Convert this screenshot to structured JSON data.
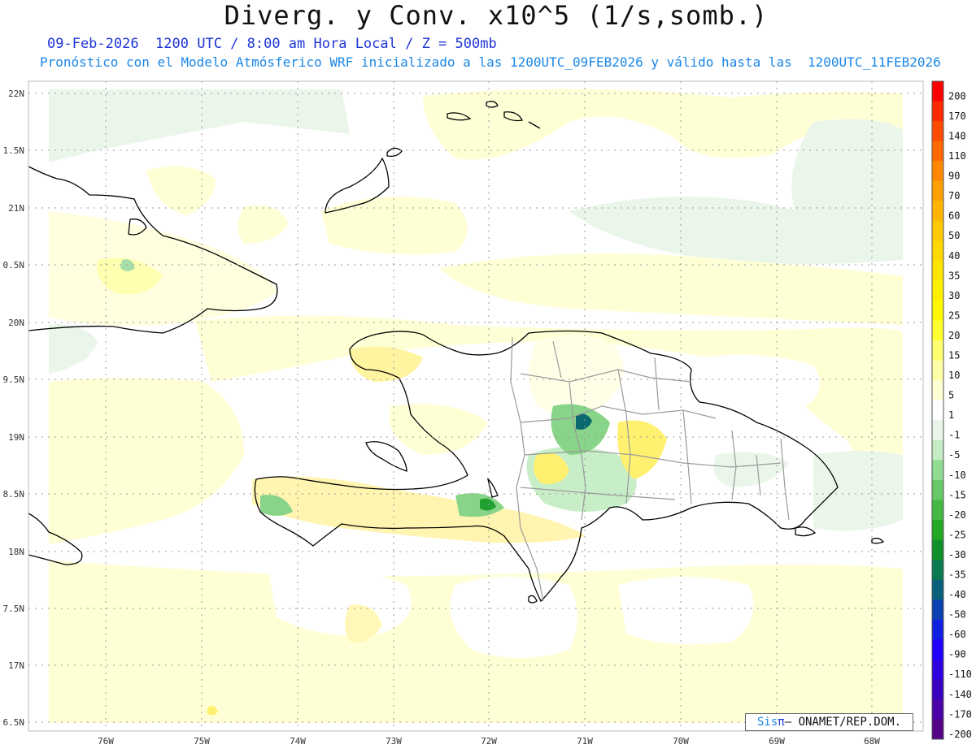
{
  "header": {
    "title": "Diverg. y Conv. x10^5 (1/s,somb.)",
    "subtitle_1": "09-Feb-2026  1200 UTC / 8:00 am Hora Local / Z = 500mb",
    "subtitle_2": "Pronóstico con el Modelo Atmósferico WRF inicializado a las 1200UTC_09FEB2026 y válido hasta las  1200UTC_11FEB2026"
  },
  "map": {
    "lat_labels": [
      "22N",
      "1.5N",
      "21N",
      "0.5N",
      "20N",
      "9.5N",
      "19N",
      "8.5N",
      "18N",
      "7.5N",
      "17N",
      "6.5N"
    ],
    "lon_labels": [
      "76W",
      "75W",
      "74W",
      "73W",
      "72W",
      "71W",
      "70W",
      "69W",
      "68W"
    ],
    "region": "Hispaniola / Caribe"
  },
  "colorbar": {
    "labels": [
      "200",
      "170",
      "140",
      "110",
      "90",
      "70",
      "60",
      "50",
      "40",
      "35",
      "30",
      "25",
      "20",
      "15",
      "10",
      "5",
      "1",
      "-1",
      "-5",
      "-10",
      "-15",
      "-20",
      "-25",
      "-30",
      "-35",
      "-40",
      "-50",
      "-60",
      "-90",
      "-110",
      "-140",
      "-170",
      "-200"
    ],
    "colors": [
      "#ff0000",
      "#ff2a00",
      "#ff4a00",
      "#ff6a00",
      "#ff8800",
      "#ffa000",
      "#ffb400",
      "#ffc800",
      "#ffd800",
      "#ffe400",
      "#fff000",
      "#fffa00",
      "#ffff30",
      "#ffff70",
      "#ffffa8",
      "#ffffd4",
      "#ffffff",
      "#e8f5e8",
      "#c4ecc4",
      "#90dc90",
      "#66c866",
      "#44b844",
      "#22a822",
      "#10902a",
      "#0a7a50",
      "#08607a",
      "#0a40b0",
      "#1020e0",
      "#2000ff",
      "#3000e0",
      "#3a00c0",
      "#4a00a8",
      "#550088"
    ]
  },
  "credit": {
    "brand": "Sis",
    "pi": "π",
    "text": "– ONAMET/REP.DOM."
  }
}
